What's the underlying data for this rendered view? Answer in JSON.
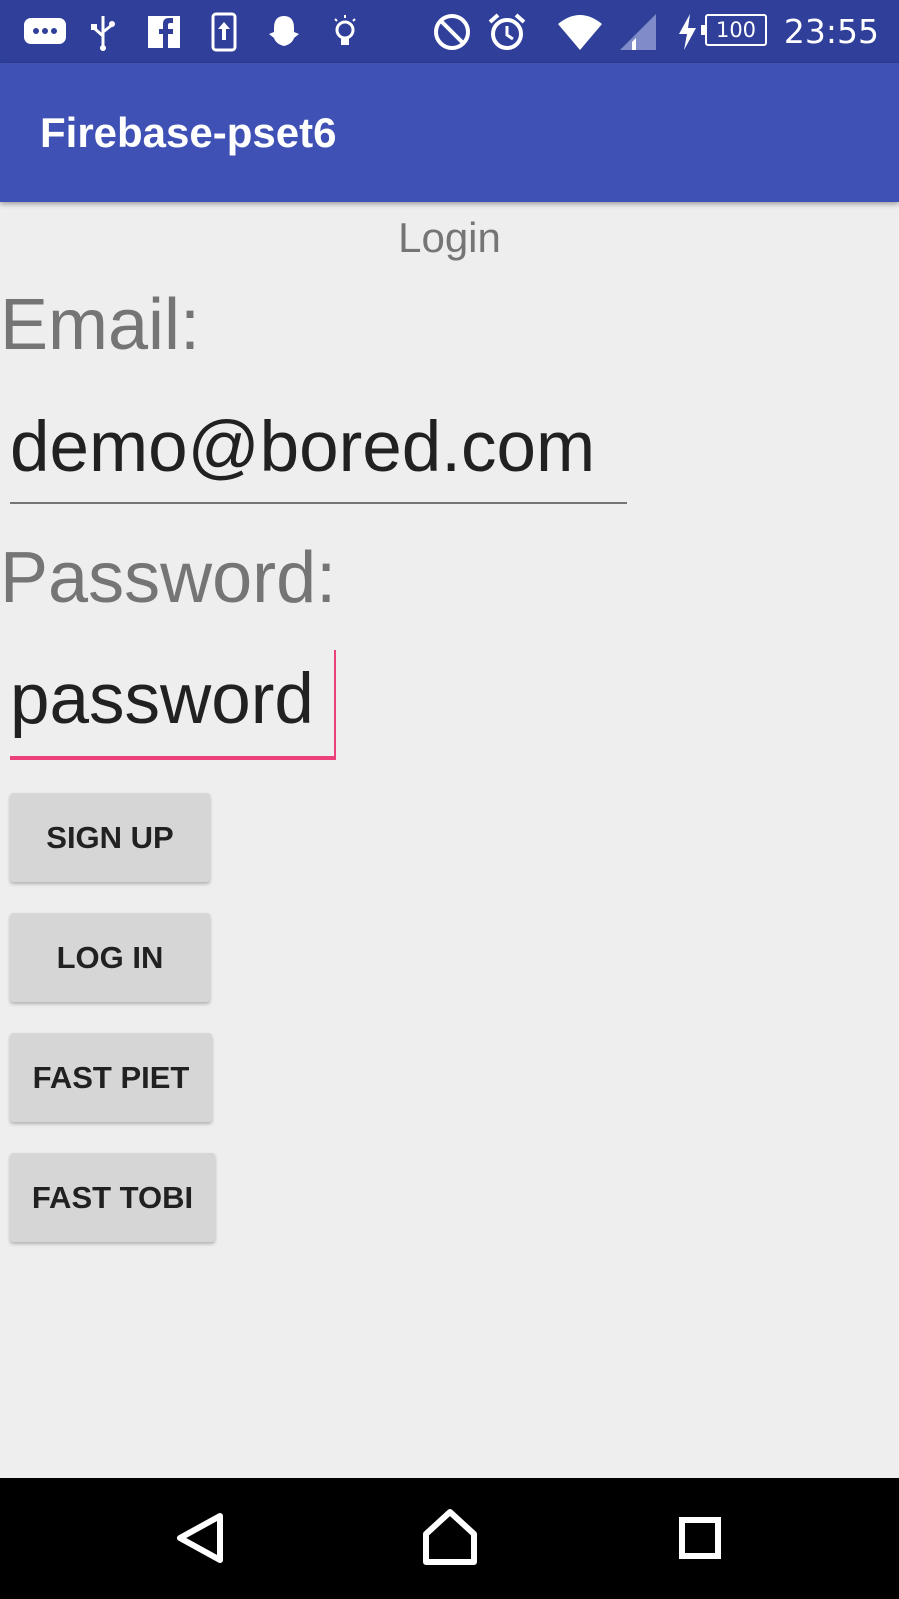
{
  "status_bar": {
    "time": "23:55",
    "battery_level": "100",
    "icons_left": [
      "messages-icon",
      "usb-icon",
      "facebook-icon",
      "upload-icon",
      "snapchat-icon",
      "lightbulb-icon"
    ],
    "icons_right": [
      "do-not-disturb-icon",
      "alarm-icon",
      "wifi-icon",
      "cell-signal-icon",
      "charging-icon"
    ]
  },
  "app_bar": {
    "title": "Firebase-pset6"
  },
  "screen": {
    "heading": "Login"
  },
  "form": {
    "email_label": "Email:",
    "email_value": "demo@bored.com",
    "password_label": "Password:",
    "password_value": "password"
  },
  "buttons": {
    "sign_up": "SIGN UP",
    "log_in": "LOG IN",
    "fast_piet": "FAST PIET",
    "fast_tobi": "FAST TOBI"
  },
  "colors": {
    "primary": "#3f51b5",
    "primary_dark": "#2f3f9a",
    "accent": "#ec407a"
  },
  "nav_bar": {
    "icons": [
      "back-icon",
      "home-icon",
      "recents-icon"
    ]
  }
}
